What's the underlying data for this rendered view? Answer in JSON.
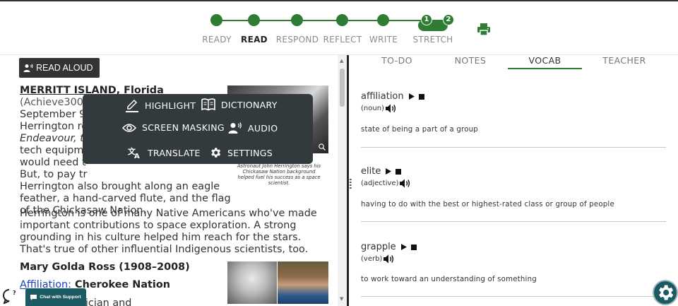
{
  "stepper": {
    "steps": [
      "READY",
      "READ",
      "RESPOND",
      "REFLECT",
      "WRITE",
      "STRETCH"
    ],
    "active": "READ",
    "stretch_badges": [
      "1",
      "2"
    ],
    "accent": "#2e7d32"
  },
  "reader": {
    "read_aloud_label": "READ ALOUD",
    "p1_lines": [
      "September 9",
      "Herrington ro",
      "Endeavour, th",
      "tech equipme",
      "would need t",
      "But, to pay tr",
      "Herrington also brought along an eagle",
      "feather, a hand-carved flute, and the flag",
      "of the Chickasaw Nation."
    ],
    "dateline_bold": "MERRITT ISLAND, Florida",
    "dateline_rest": " (Achieve3000,",
    "p2": "Herrington is one of many Native Americans who've made important contributions to space exploration. A strong grounding in his culture helped him reach for the stars. That's true of other influential Indigenous scientists, too.",
    "subhead": "Mary Golda Ross (1908–2008)",
    "affiliation_link": "Affiliation:",
    "affiliation_value": " Cherokee Nation",
    "cut_line": "athematician and",
    "caption": "Astronaut John Herrington says his Chickasaw Nation background helped fuel his success as a space scientist."
  },
  "tools": {
    "highlight": "HIGHLIGHT",
    "dictionary": "DICTIONARY",
    "screen_masking": "SCREEN MASKING",
    "audio": "AUDIO",
    "translate": "TRANSLATE",
    "settings": "SETTINGS"
  },
  "tabs": [
    "TO-DO",
    "NOTES",
    "VOCAB",
    "TEACHER"
  ],
  "active_tab": "VOCAB",
  "vocab": [
    {
      "word": "affiliation",
      "pos": "(noun)",
      "definition": "state of being a part of a group"
    },
    {
      "word": "elite",
      "pos": "(adjective)",
      "definition": "having to do with the best or highest-rated class or group of people"
    },
    {
      "word": "grapple",
      "pos": "(verb)",
      "definition": "to work toward an understanding of something"
    }
  ],
  "chat": {
    "label": "Chat with Support"
  }
}
